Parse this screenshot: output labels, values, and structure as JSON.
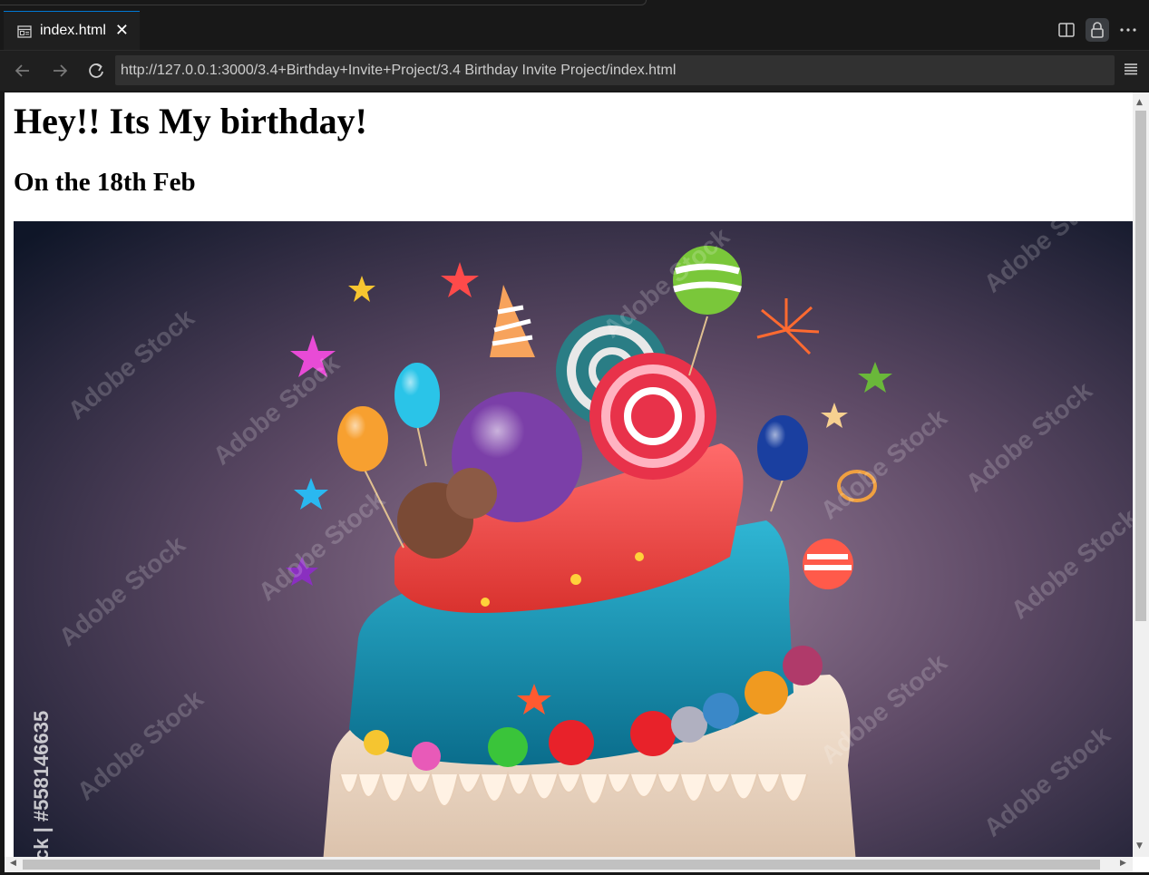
{
  "tab": {
    "icon": "preview-icon",
    "label": "index.html",
    "close_icon": "close-icon"
  },
  "tab_actions": [
    {
      "name": "split-editor-icon"
    },
    {
      "name": "lock-icon"
    },
    {
      "name": "more-actions-icon",
      "glyph": "···"
    }
  ],
  "nav": {
    "back_icon": "arrow-left-icon",
    "forward_icon": "arrow-right-icon",
    "reload_icon": "reload-icon",
    "url": "http://127.0.0.1:3000/3.4+Birthday+Invite+Project/3.4 Birthday Invite Project/index.html",
    "menu_icon": "hamburger-menu-icon"
  },
  "page": {
    "heading": "Hey!! Its My birthday!",
    "subheading": "On the 18th Feb",
    "image": {
      "semantic": "birthday-cake-image",
      "watermark": "Adobe Stock",
      "side_text": "ck | #558146635"
    }
  },
  "colors": {
    "editor_bg": "#181818",
    "accent": "#0078d4",
    "url_bg": "#313131"
  }
}
